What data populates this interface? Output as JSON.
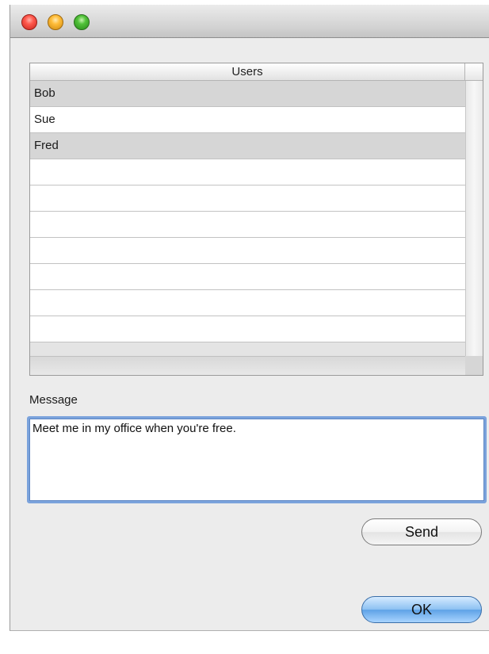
{
  "window": {
    "title": ""
  },
  "users_table": {
    "column_header": "Users",
    "rows": [
      "Bob",
      "Sue",
      "Fred",
      "",
      "",
      "",
      "",
      "",
      "",
      "",
      ""
    ]
  },
  "message": {
    "label": "Message",
    "value": "Meet me in my office when you're free."
  },
  "buttons": {
    "send_label": "Send",
    "ok_label": "OK"
  },
  "colors": {
    "row_alternate": "#d6d6d6",
    "focus_ring": "#7ba3dc",
    "default_button": "#5ea2e6"
  }
}
